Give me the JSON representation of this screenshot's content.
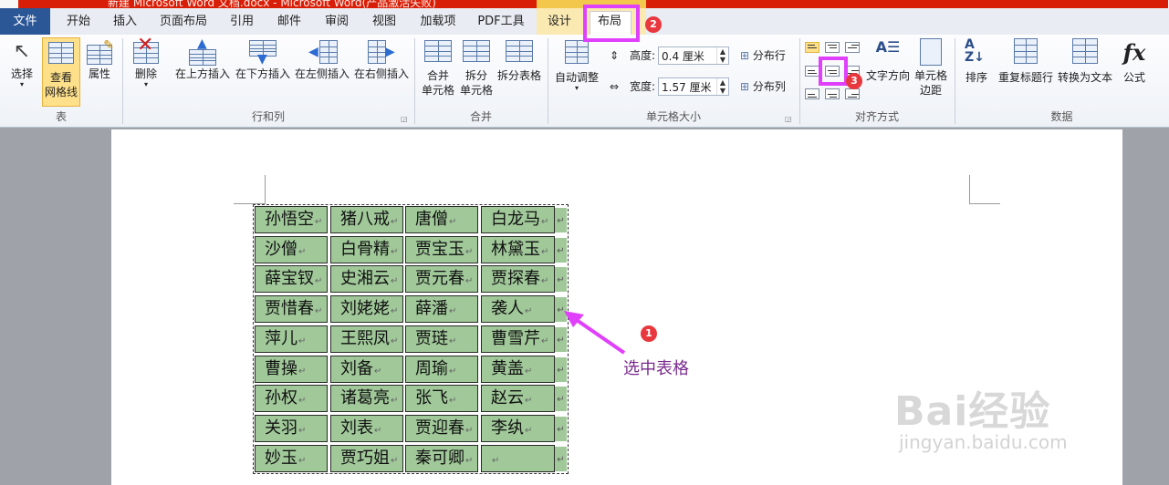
{
  "window": {
    "title": "新建 Microsoft Word 文档.docx - Microsoft Word(产品激活失败)"
  },
  "tabs": [
    {
      "label": "文件"
    },
    {
      "label": "开始"
    },
    {
      "label": "插入"
    },
    {
      "label": "页面布局"
    },
    {
      "label": "引用"
    },
    {
      "label": "邮件"
    },
    {
      "label": "审阅"
    },
    {
      "label": "视图"
    },
    {
      "label": "加载项"
    },
    {
      "label": "PDF工具"
    },
    {
      "label": "设计"
    },
    {
      "label": "布局"
    }
  ],
  "ribbon": {
    "table_group": {
      "label": "表",
      "select": "选择",
      "gridlines_1": "查看",
      "gridlines_2": "网格线",
      "properties": "属性"
    },
    "rows_cols_group": {
      "label": "行和列",
      "delete": "删除",
      "insert_above": "在上方插入",
      "insert_below": "在下方插入",
      "insert_left": "在左侧插入",
      "insert_right": "在右侧插入"
    },
    "merge_group": {
      "label": "合并",
      "merge_1": "合并",
      "merge_2": "单元格",
      "split_1": "拆分",
      "split_2": "单元格",
      "split_table": "拆分表格"
    },
    "cell_size_group": {
      "label": "单元格大小",
      "autofit": "自动调整",
      "height_label": "高度:",
      "height_value": "0.4 厘米",
      "width_label": "宽度:",
      "width_value": "1.57 厘米",
      "distribute_rows": "分布行",
      "distribute_cols": "分布列"
    },
    "alignment_group": {
      "label": "对齐方式",
      "text_direction": "文字方向",
      "cell_margins_1": "单元格",
      "cell_margins_2": "边距"
    },
    "data_group": {
      "label": "数据",
      "sort": "排序",
      "repeat_header": "重复标题行",
      "convert_text": "转换为文本",
      "formula": "公式"
    }
  },
  "table": {
    "rows": [
      [
        "孙悟空",
        "猪八戒",
        "唐僧",
        "白龙马"
      ],
      [
        "沙僧",
        "白骨精",
        "贾宝玉",
        "林黛玉"
      ],
      [
        "薛宝钗",
        "史湘云",
        "贾元春",
        "贾探春"
      ],
      [
        "贾惜春",
        "刘姥姥",
        "薛潘",
        "袭人"
      ],
      [
        "萍儿",
        "王熙凤",
        "贾琏",
        "曹雪芹"
      ],
      [
        "曹操",
        "刘备",
        "周瑜",
        "黄盖"
      ],
      [
        "孙权",
        "诸葛亮",
        "张飞",
        "赵云"
      ],
      [
        "关羽",
        "刘表",
        "贾迎春",
        "李纨"
      ],
      [
        "妙玉",
        "贾巧姐",
        "秦可卿",
        ""
      ]
    ],
    "cell_mark": "↵",
    "fill_color": "#a0c899"
  },
  "annotations": {
    "badge_1": "1",
    "badge_2": "2",
    "badge_3": "3",
    "note": "选中表格",
    "highlight_color": "#e040fb"
  },
  "watermark": {
    "line1": "Bai经验",
    "line2": "jingyan.baidu.com"
  }
}
